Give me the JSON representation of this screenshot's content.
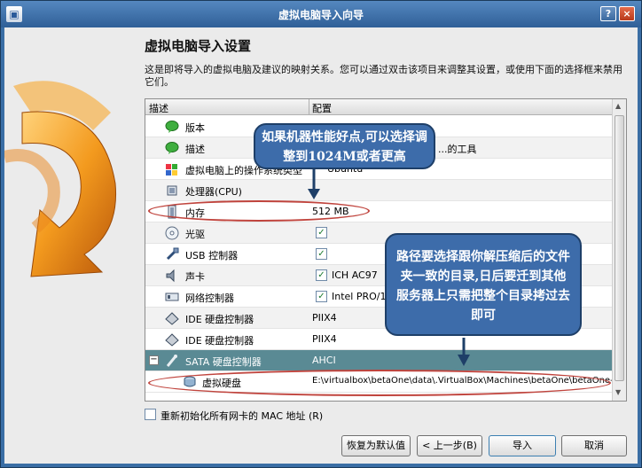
{
  "window": {
    "title": "虚拟电脑导入向导",
    "help_label": "?",
    "close_label": "×"
  },
  "header": {
    "heading": "虚拟电脑导入设置",
    "description": "这是即将导入的虚拟电脑及建议的映射关系。您可以通过双击该项目来调整其设置，或使用下面的选择框来禁用它们。"
  },
  "table": {
    "col_description": "描述",
    "col_config": "配置",
    "rows": [
      {
        "label": "版本",
        "value": ""
      },
      {
        "label": "描述",
        "value": "...的工具"
      },
      {
        "label": "虚拟电脑上的操作系统类型",
        "value": "Ubuntu"
      },
      {
        "label": "处理器(CPU)",
        "value": ""
      },
      {
        "label": "内存",
        "value": "512 MB"
      },
      {
        "label": "光驱",
        "value": ""
      },
      {
        "label": "USB 控制器",
        "value": ""
      },
      {
        "label": "声卡",
        "value": "ICH AC97"
      },
      {
        "label": "网络控制器",
        "value": "Intel PRO/100..."
      },
      {
        "label": "IDE 硬盘控制器",
        "value": "PIIX4"
      },
      {
        "label": "IDE 硬盘控制器",
        "value": "PIIX4"
      },
      {
        "label": "SATA 硬盘控制器",
        "value": "AHCI"
      },
      {
        "label": "虚拟硬盘",
        "value": "E:\\virtualbox\\betaOne\\data\\.VirtualBox\\Machines\\betaOne\\betaOne-..."
      }
    ]
  },
  "annotations": {
    "memory_note": "如果机器性能好点,可以选择调整到1024M或者更高",
    "path_note": "路径要选择跟你解压缩后的文件夹一致的目录,日后要迁到其他服务器上只需把整个目录拷过去即可"
  },
  "options": {
    "reinit_mac": "重新初始化所有网卡的 MAC 地址 (R)"
  },
  "buttons": {
    "restore_defaults": "恢复为默认值",
    "back": "< 上一步(B)",
    "import": "导入",
    "cancel": "取消"
  },
  "colors": {
    "titlebar": "#2f5f97",
    "selected_row": "#5a8a94",
    "note_fill": "#3d6caa",
    "highlight_ellipse": "#c0443d"
  }
}
